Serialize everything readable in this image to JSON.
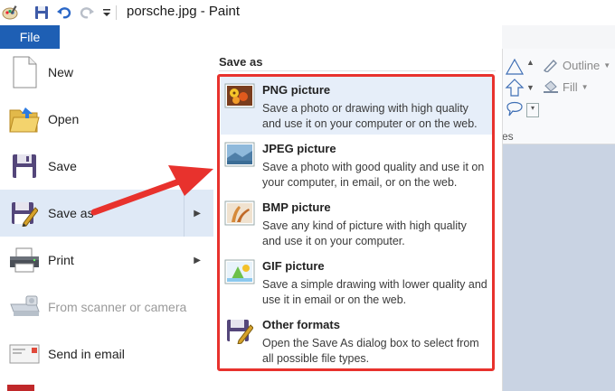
{
  "window": {
    "title": "porsche.jpg - Paint"
  },
  "file_tab": {
    "label": "File"
  },
  "ribbon": {
    "outline_label": "Outline",
    "fill_label": "Fill",
    "group_fragment": "es"
  },
  "file_menu": {
    "items": [
      {
        "label": "New",
        "icon": "new-document-icon",
        "enabled": true
      },
      {
        "label": "Open",
        "icon": "open-folder-icon",
        "enabled": true
      },
      {
        "label": "Save",
        "icon": "floppy-disk-icon",
        "enabled": true
      },
      {
        "label": "Save as",
        "icon": "save-as-icon",
        "enabled": true,
        "selected": true,
        "has_submenu": true
      },
      {
        "label": "Print",
        "icon": "printer-icon",
        "enabled": true,
        "has_submenu": true
      },
      {
        "label": "From scanner or camera",
        "icon": "scanner-icon",
        "enabled": false
      },
      {
        "label": "Send in email",
        "icon": "email-icon",
        "enabled": true
      }
    ]
  },
  "save_as_panel": {
    "header": "Save as",
    "options": [
      {
        "title": "PNG picture",
        "description": "Save a photo or drawing with high quality and use it on your computer or on the web.",
        "icon": "png-picture-icon"
      },
      {
        "title": "JPEG picture",
        "description": "Save a photo with good quality and use it on your computer, in email, or on the web.",
        "icon": "jpeg-picture-icon"
      },
      {
        "title": "BMP picture",
        "description": "Save any kind of picture with high quality and use it on your computer.",
        "icon": "bmp-picture-icon"
      },
      {
        "title": "GIF picture",
        "description": "Save a simple drawing with lower quality and use it in email or on the web.",
        "icon": "gif-picture-icon"
      },
      {
        "title": "Other formats",
        "description": "Open the Save As dialog box to select from all possible file types.",
        "icon": "other-formats-icon"
      }
    ]
  },
  "colors": {
    "file_tab": "#1e5fb4",
    "annotation_red": "#e8322d",
    "selected_row": "#dfe9f6"
  }
}
